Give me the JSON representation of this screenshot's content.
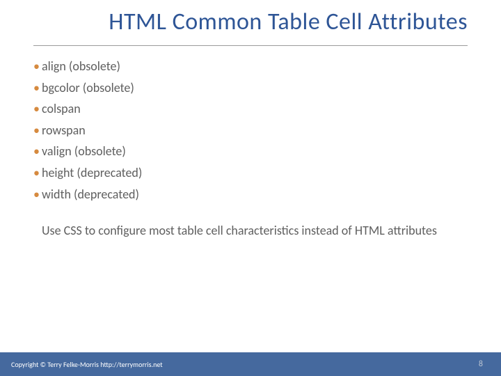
{
  "title": "HTML Common Table Cell Attributes",
  "bullets": [
    "align  (obsolete)",
    "bgcolor (obsolete)",
    "colspan",
    "rowspan",
    "valign (obsolete)",
    "height (deprecated)",
    "width (deprecated)"
  ],
  "note": "Use CSS to configure most table cell characteristics instead of HTML attributes",
  "footer": {
    "copyright": "Copyright © Terry Felke-Morris http://terrymorris.net",
    "page": "8"
  },
  "colors": {
    "title": "#2e5596",
    "bullet": "#d68a3f",
    "body": "#5f5f5f",
    "footer_bg": "#45699e"
  }
}
